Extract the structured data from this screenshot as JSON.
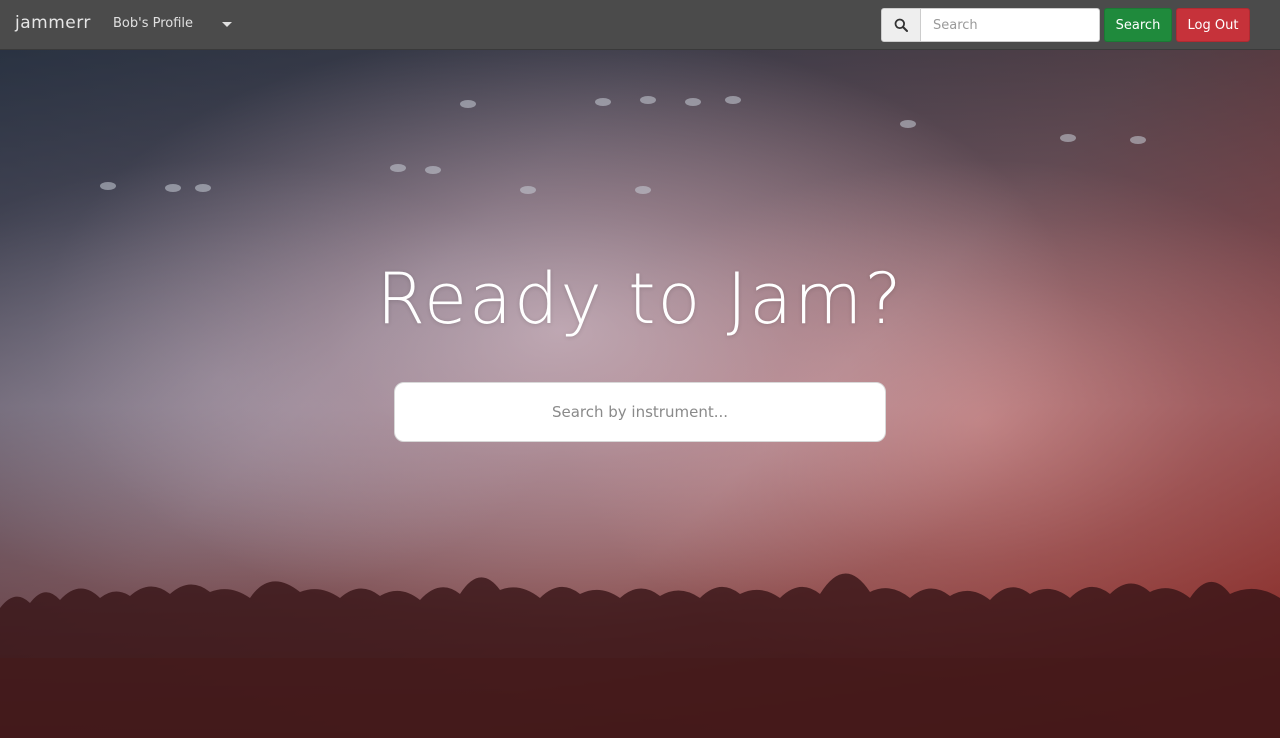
{
  "navbar": {
    "brand": "jammerr",
    "profile_label": "Bob's Profile",
    "search_placeholder": "Search",
    "search_button_label": "Search",
    "logout_button_label": "Log Out",
    "search_icon": "search-icon",
    "dropdown_icon": "caret-down-icon"
  },
  "hero": {
    "headline": "Ready to Jam?",
    "instrument_search_placeholder": "Search by instrument..."
  },
  "colors": {
    "navbar_bg": "#4b4b4b",
    "search_button": "#1f8a3c",
    "logout_button": "#c6323a"
  }
}
